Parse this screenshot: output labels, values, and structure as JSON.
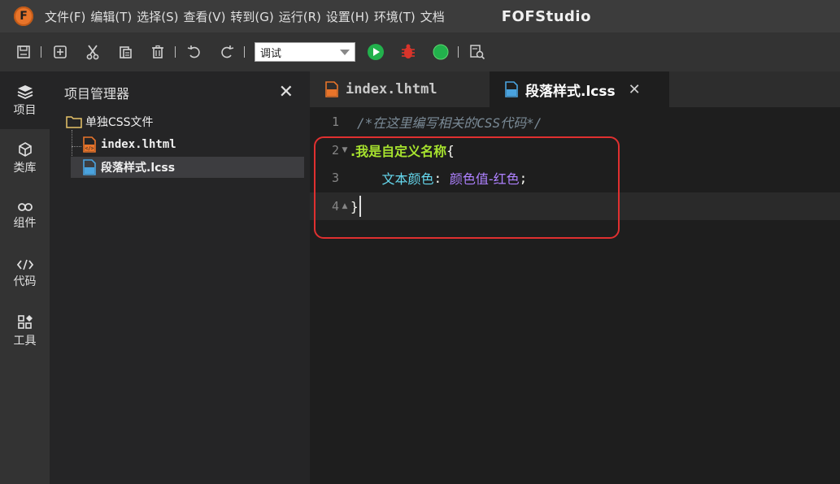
{
  "menubar": {
    "items": [
      "文件(F)",
      "编辑(T)",
      "选择(S)",
      "查看(V)",
      "转到(G)",
      "运行(R)",
      "设置(H)",
      "环境(T)",
      "文档"
    ],
    "logo_letter": "F",
    "app_title": "FOFStudio"
  },
  "toolbar": {
    "mode_select": "调试"
  },
  "activity": {
    "items": [
      {
        "label": "项目",
        "icon": "layers-icon"
      },
      {
        "label": "类库",
        "icon": "cube-icon"
      },
      {
        "label": "组件",
        "icon": "link-icon"
      },
      {
        "label": "代码",
        "icon": "code-icon"
      },
      {
        "label": "工具",
        "icon": "tools-icon"
      }
    ]
  },
  "explorer": {
    "title": "项目管理器",
    "close": "✕",
    "folder": "单独CSS文件",
    "files": [
      "index.lhtml",
      "段落样式.lcss"
    ]
  },
  "tabs": [
    {
      "label": "index.lhtml"
    },
    {
      "label": "段落样式.lcss",
      "close": "✕"
    }
  ],
  "editor": {
    "lines": [
      {
        "num": "1",
        "comment": "/*在这里编写相关的CSS代码*/"
      },
      {
        "num": "2",
        "selector": ".我是自定义名称",
        "brace": "{"
      },
      {
        "num": "3",
        "indent": "    ",
        "property": "文本颜色",
        "colon": ": ",
        "value": "颜色值-红色",
        "semi": ";"
      },
      {
        "num": "4",
        "brace": "}"
      }
    ]
  },
  "colors": {
    "accent_red": "#e03030",
    "run_green": "#22b14c",
    "debug_red": "#d9342b",
    "logo_orange": "#e8742a"
  }
}
